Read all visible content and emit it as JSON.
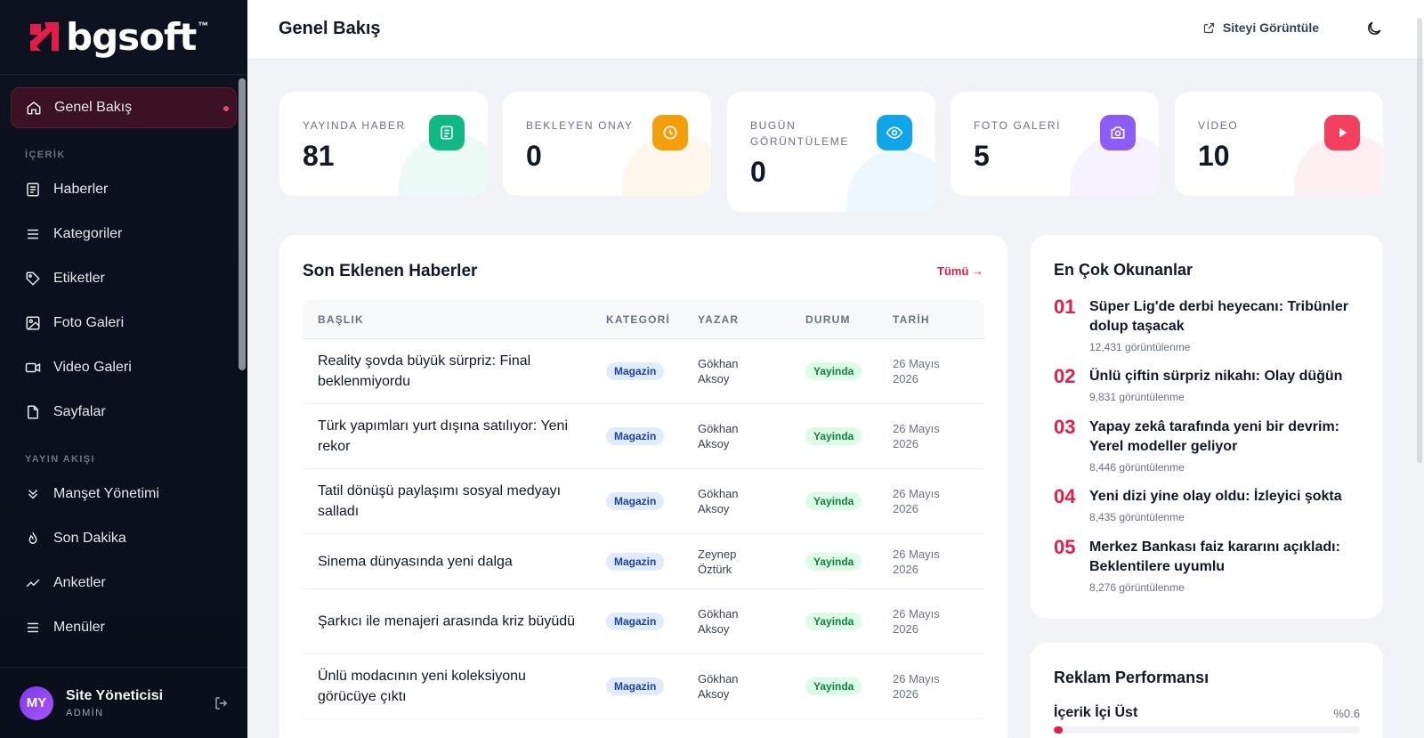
{
  "brand": {
    "name": "bgsoft",
    "tm": "™",
    "accent": "#e11d48"
  },
  "sidebar": {
    "active": {
      "label": "Genel Bakış",
      "icon": "home-icon"
    },
    "sections": [
      {
        "title": "İÇERİK",
        "items": [
          {
            "label": "Haberler",
            "icon": "newspaper-icon"
          },
          {
            "label": "Kategoriler",
            "icon": "list-icon"
          },
          {
            "label": "Etiketler",
            "icon": "tag-icon"
          },
          {
            "label": "Foto Galeri",
            "icon": "image-icon"
          },
          {
            "label": "Video Galeri",
            "icon": "video-icon"
          },
          {
            "label": "Sayfalar",
            "icon": "file-icon"
          }
        ]
      },
      {
        "title": "YAYIN AKIŞI",
        "items": [
          {
            "label": "Manşet Yönetimi",
            "icon": "chevrons-down-icon"
          },
          {
            "label": "Son Dakika",
            "icon": "flame-icon"
          },
          {
            "label": "Anketler",
            "icon": "trend-icon"
          },
          {
            "label": "Menüler",
            "icon": "menu-icon"
          }
        ]
      }
    ],
    "user": {
      "initials": "MY",
      "name": "Site Yöneticisi",
      "role": "ADMİN"
    }
  },
  "header": {
    "title": "Genel Bakış",
    "view_site": "Siteyi Görüntüle"
  },
  "stats": [
    {
      "label": "YAYINDA HABER",
      "value": "81",
      "color": "#10b981",
      "icon": "newspaper-icon"
    },
    {
      "label": "BEKLEYEN ONAY",
      "value": "0",
      "color": "#f59e0b",
      "icon": "clock-icon"
    },
    {
      "label": "BUGÜN GÖRÜNTÜLEME",
      "value": "0",
      "color": "#0ea5e9",
      "icon": "eye-icon"
    },
    {
      "label": "FOTO GALERİ",
      "value": "5",
      "color": "#8b5cf6",
      "icon": "camera-icon"
    },
    {
      "label": "VİDEO",
      "value": "10",
      "color": "#f43f5e",
      "icon": "play-icon"
    }
  ],
  "recent": {
    "title": "Son Eklenen Haberler",
    "all_link": "Tümü →",
    "columns": [
      "BAŞLIK",
      "KATEGORİ",
      "YAZAR",
      "DURUM",
      "TARİH"
    ],
    "rows": [
      {
        "title": "Reality şovda büyük sürpriz: Final beklenmiyordu",
        "category": "Magazin",
        "author": "Gökhan Aksoy",
        "status": "Yayinda",
        "date": "26 Mayıs 2026"
      },
      {
        "title": "Türk yapımları yurt dışına satılıyor: Yeni rekor",
        "category": "Magazin",
        "author": "Gökhan Aksoy",
        "status": "Yayinda",
        "date": "26 Mayıs 2026"
      },
      {
        "title": "Tatil dönüşü paylaşımı sosyal medyayı salladı",
        "category": "Magazin",
        "author": "Gökhan Aksoy",
        "status": "Yayinda",
        "date": "26 Mayıs 2026"
      },
      {
        "title": "Sinema dünyasında yeni dalga",
        "category": "Magazin",
        "author": "Zeynep Öztürk",
        "status": "Yayinda",
        "date": "26 Mayıs 2026"
      },
      {
        "title": "Şarkıcı ile menajeri arasında kriz büyüdü",
        "category": "Magazin",
        "author": "Gökhan Aksoy",
        "status": "Yayinda",
        "date": "26 Mayıs 2026"
      },
      {
        "title": "Ünlü modacının yeni koleksiyonu görücüye çıktı",
        "category": "Magazin",
        "author": "Gökhan Aksoy",
        "status": "Yayinda",
        "date": "26 Mayıs 2026"
      }
    ]
  },
  "most_read": {
    "title": "En Çok Okunanlar",
    "items": [
      {
        "rank": "01",
        "title": "Süper Lig'de derbi heyecanı: Tribünler dolup taşacak",
        "views": "12,431 görüntülenme"
      },
      {
        "rank": "02",
        "title": "Ünlü çiftin sürpriz nikahı: Olay düğün",
        "views": "9,831 görüntülenme"
      },
      {
        "rank": "03",
        "title": "Yapay zekâ tarafında yeni bir devrim: Yerel modeller geliyor",
        "views": "8,446 görüntülenme"
      },
      {
        "rank": "04",
        "title": "Yeni dizi yine olay oldu: İzleyici şokta",
        "views": "8,435 görüntülenme"
      },
      {
        "rank": "05",
        "title": "Merkez Bankası faiz kararını açıkladı: Beklentilere uyumlu",
        "views": "8,276 görüntülenme"
      }
    ]
  },
  "ads": {
    "title": "Reklam Performansı",
    "items": [
      {
        "label": "İçerik İçi Üst",
        "pct_text": "%0.6",
        "pct": 0.6
      }
    ]
  }
}
